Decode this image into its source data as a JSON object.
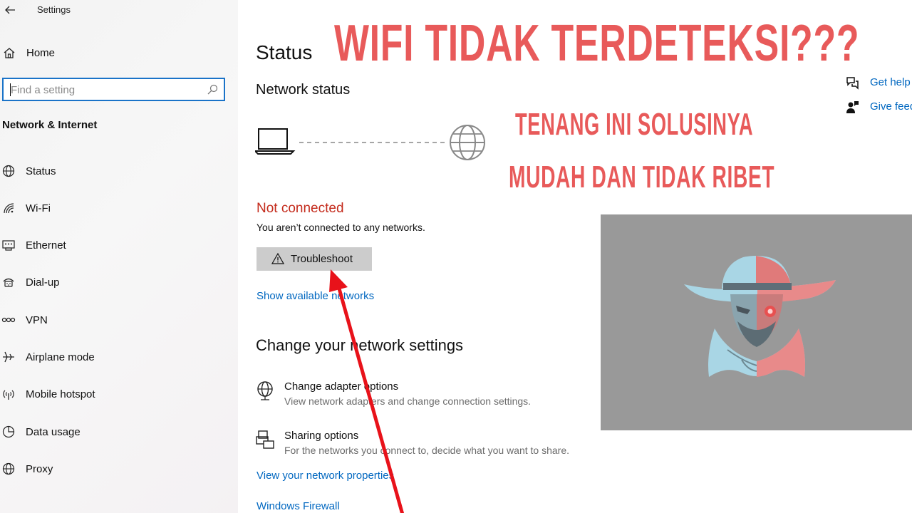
{
  "window": {
    "app_title": "Settings",
    "back_icon": "back-arrow-icon"
  },
  "sidebar": {
    "home_label": "Home",
    "search_placeholder": "Find a setting",
    "section_title": "Network & Internet",
    "items": [
      {
        "label": "Status",
        "icon": "globe-icon"
      },
      {
        "label": "Wi-Fi",
        "icon": "wifi-icon"
      },
      {
        "label": "Ethernet",
        "icon": "ethernet-icon"
      },
      {
        "label": "Dial-up",
        "icon": "dialup-icon"
      },
      {
        "label": "VPN",
        "icon": "vpn-icon"
      },
      {
        "label": "Airplane mode",
        "icon": "airplane-icon"
      },
      {
        "label": "Mobile hotspot",
        "icon": "hotspot-icon"
      },
      {
        "label": "Data usage",
        "icon": "data-usage-icon"
      },
      {
        "label": "Proxy",
        "icon": "proxy-globe-icon"
      }
    ]
  },
  "main": {
    "page_title": "Status",
    "network_status_heading": "Network status",
    "status_text": "Not connected",
    "status_description": "You aren’t connected to any networks.",
    "troubleshoot_label": "Troubleshoot",
    "show_networks_link": "Show available networks",
    "change_heading": "Change your network settings",
    "options": [
      {
        "title": "Change adapter options",
        "description": "View network adapters and change connection settings.",
        "icon": "adapter-globe-icon"
      },
      {
        "title": "Sharing options",
        "description": "For the networks you connect to, decide what you want to share.",
        "icon": "sharing-icon"
      }
    ],
    "properties_link": "View your network properties",
    "firewall_link": "Windows Firewall"
  },
  "help": {
    "get_help": "Get help",
    "give_feedback": "Give feedback"
  },
  "overlay": {
    "caption_main": "WIFI TIDAK TERDETEKSI???",
    "caption_line1": "TENANG INI SOLUSINYA",
    "caption_line2": "MUDAH DAN TIDAK RIBET",
    "caption_color": "#e85a5a"
  },
  "colors": {
    "accent": "#0067c0",
    "error": "#c42b1c",
    "search_border": "#1a73c8",
    "arrow": "#e8121a"
  }
}
